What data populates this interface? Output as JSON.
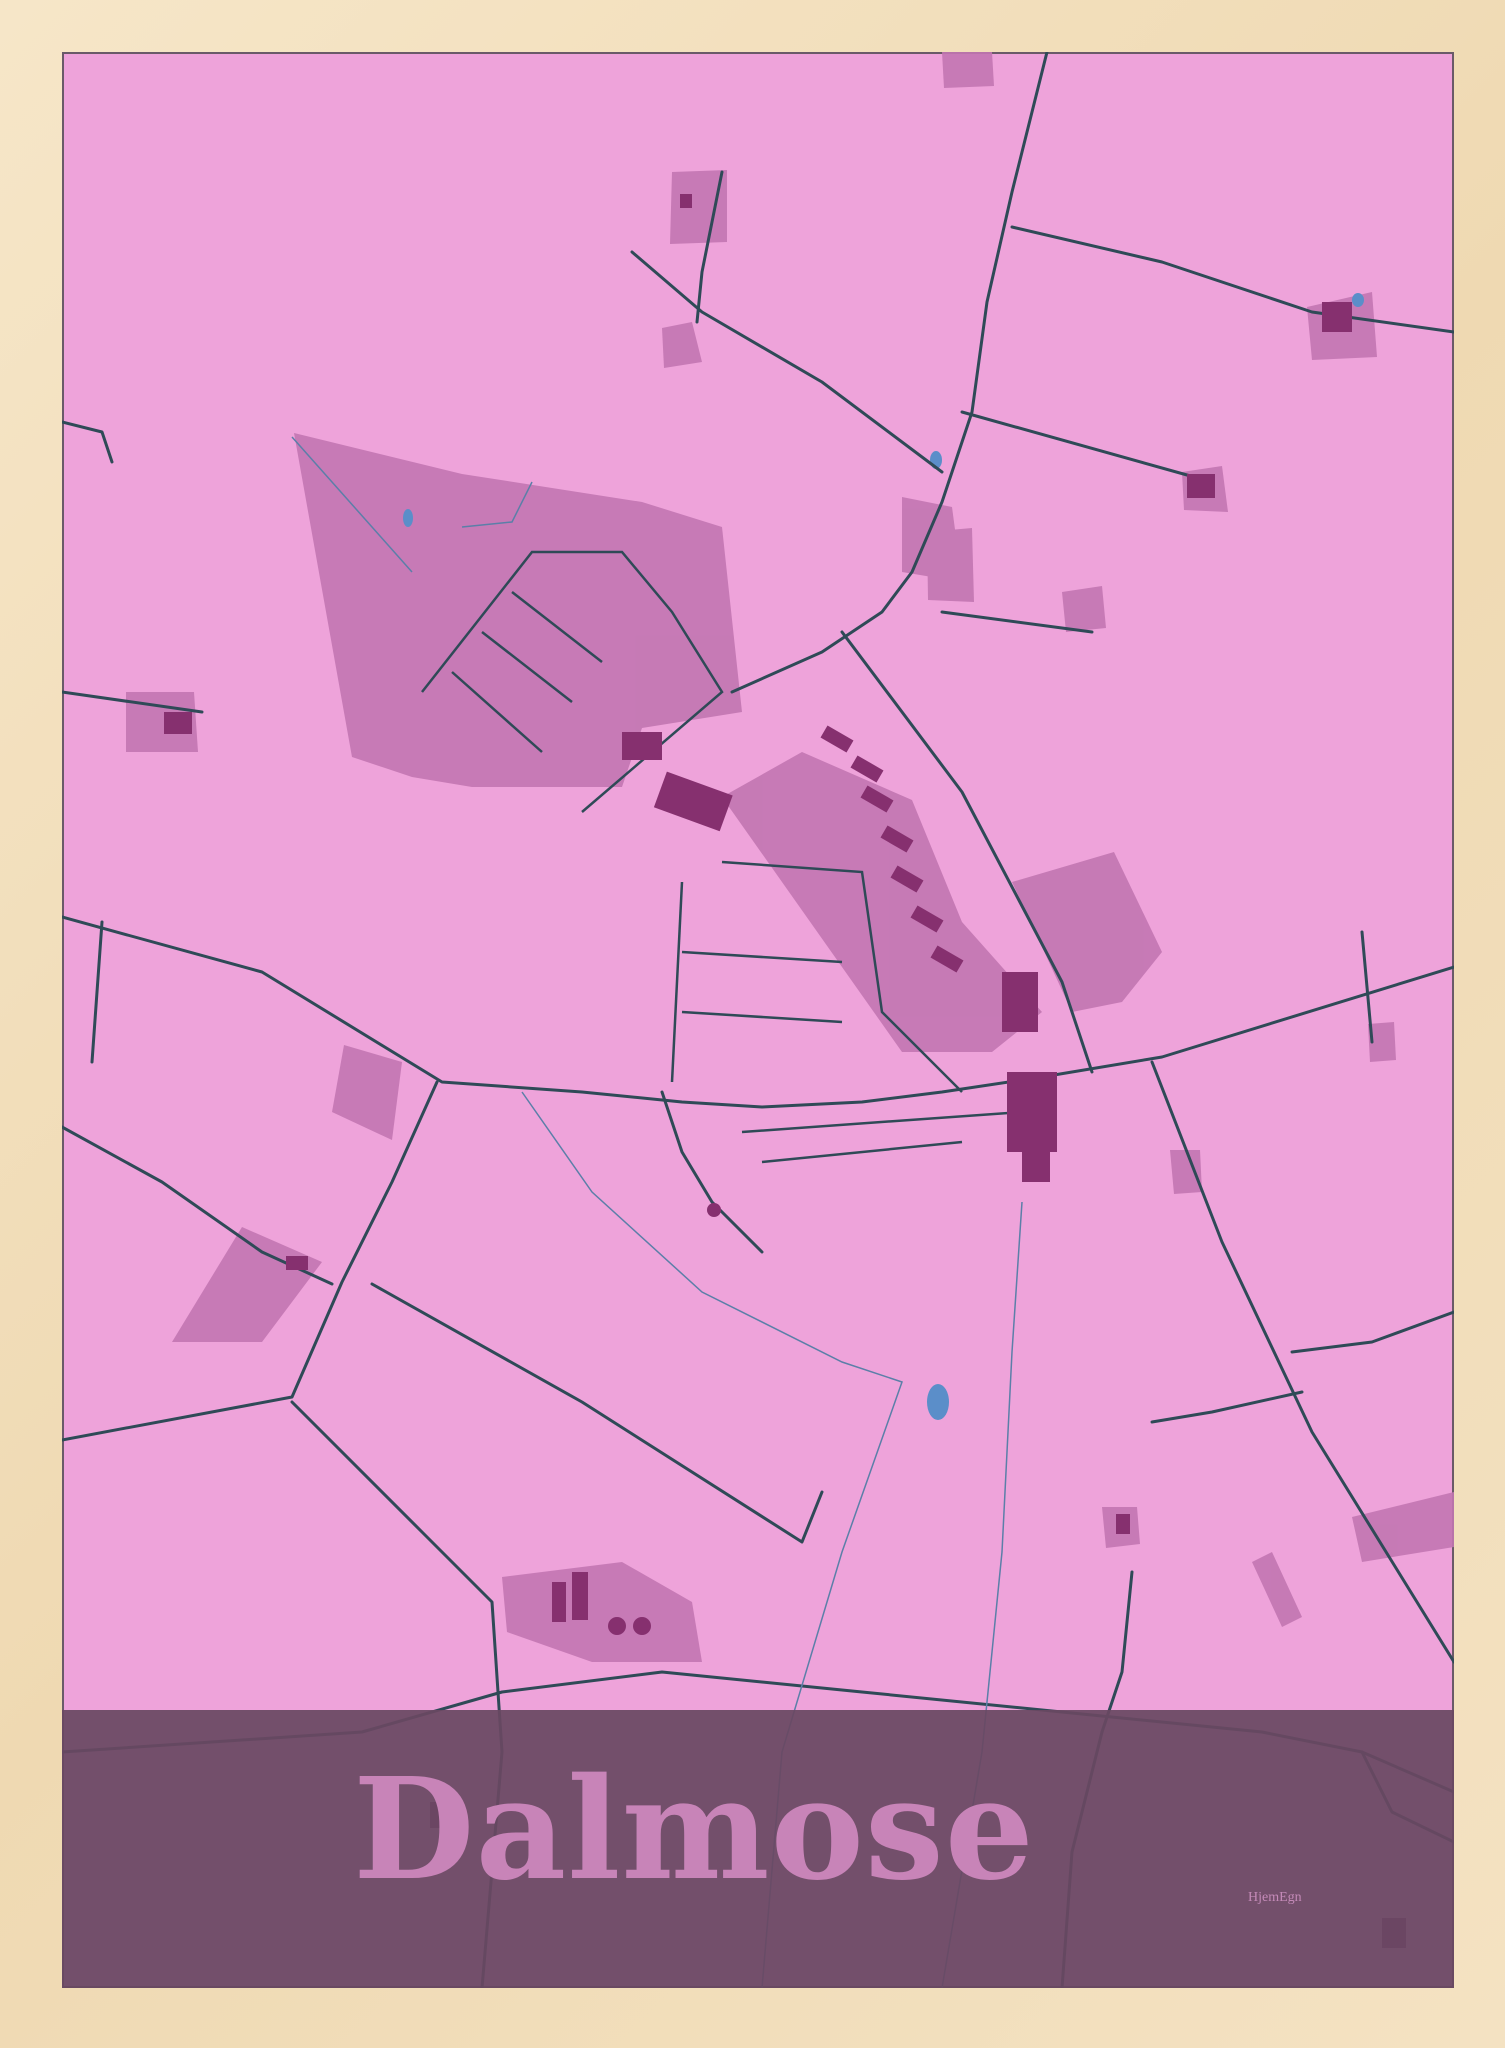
{
  "poster": {
    "city_name": "Dalmose",
    "brand": "HjemEgn"
  },
  "colors": {
    "background": "#eea3da",
    "landuse": "#c276b1",
    "buildings": "#86306f",
    "roads": "#2f4a57",
    "water": "#5b8ec9",
    "band": "#694862",
    "title": "#c884b8",
    "frame": "#f3e2c1"
  }
}
